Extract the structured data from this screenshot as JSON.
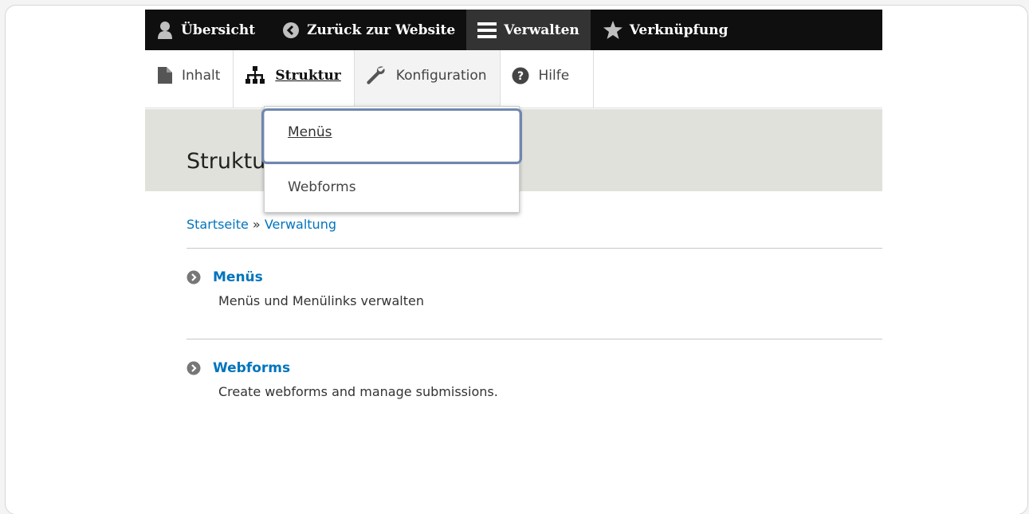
{
  "toolbar": {
    "items": [
      {
        "label": "Übersicht",
        "icon": "user-icon"
      },
      {
        "label": "Zurück zur Website",
        "icon": "chevron-left-circle-icon"
      },
      {
        "label": "Verwalten",
        "icon": "hamburger-menu-icon"
      },
      {
        "label": "Verknüpfung",
        "icon": "star-icon"
      }
    ]
  },
  "tray": {
    "items": [
      {
        "label": "Inhalt",
        "icon": "document-icon"
      },
      {
        "label": "Struktur",
        "icon": "sitemap-icon"
      },
      {
        "label": "Konfiguration",
        "icon": "wrench-icon"
      },
      {
        "label": "Hilfe",
        "icon": "help-icon"
      }
    ]
  },
  "dropdown": {
    "items": [
      {
        "label": "Menüs"
      },
      {
        "label": "Webforms"
      }
    ]
  },
  "page": {
    "title": "Struktur"
  },
  "breadcrumb": {
    "home": "Startseite",
    "separator": "»",
    "current": "Verwaltung"
  },
  "entries": [
    {
      "title": "Menüs",
      "description": "Menüs und Menülinks verwalten"
    },
    {
      "title": "Webforms",
      "description": "Create webforms and manage submissions."
    }
  ],
  "colors": {
    "toolbar_bg": "#0f0f0f",
    "link": "#0074bd",
    "highlight": "#6f87b0",
    "header_band": "#e1e1dc"
  }
}
